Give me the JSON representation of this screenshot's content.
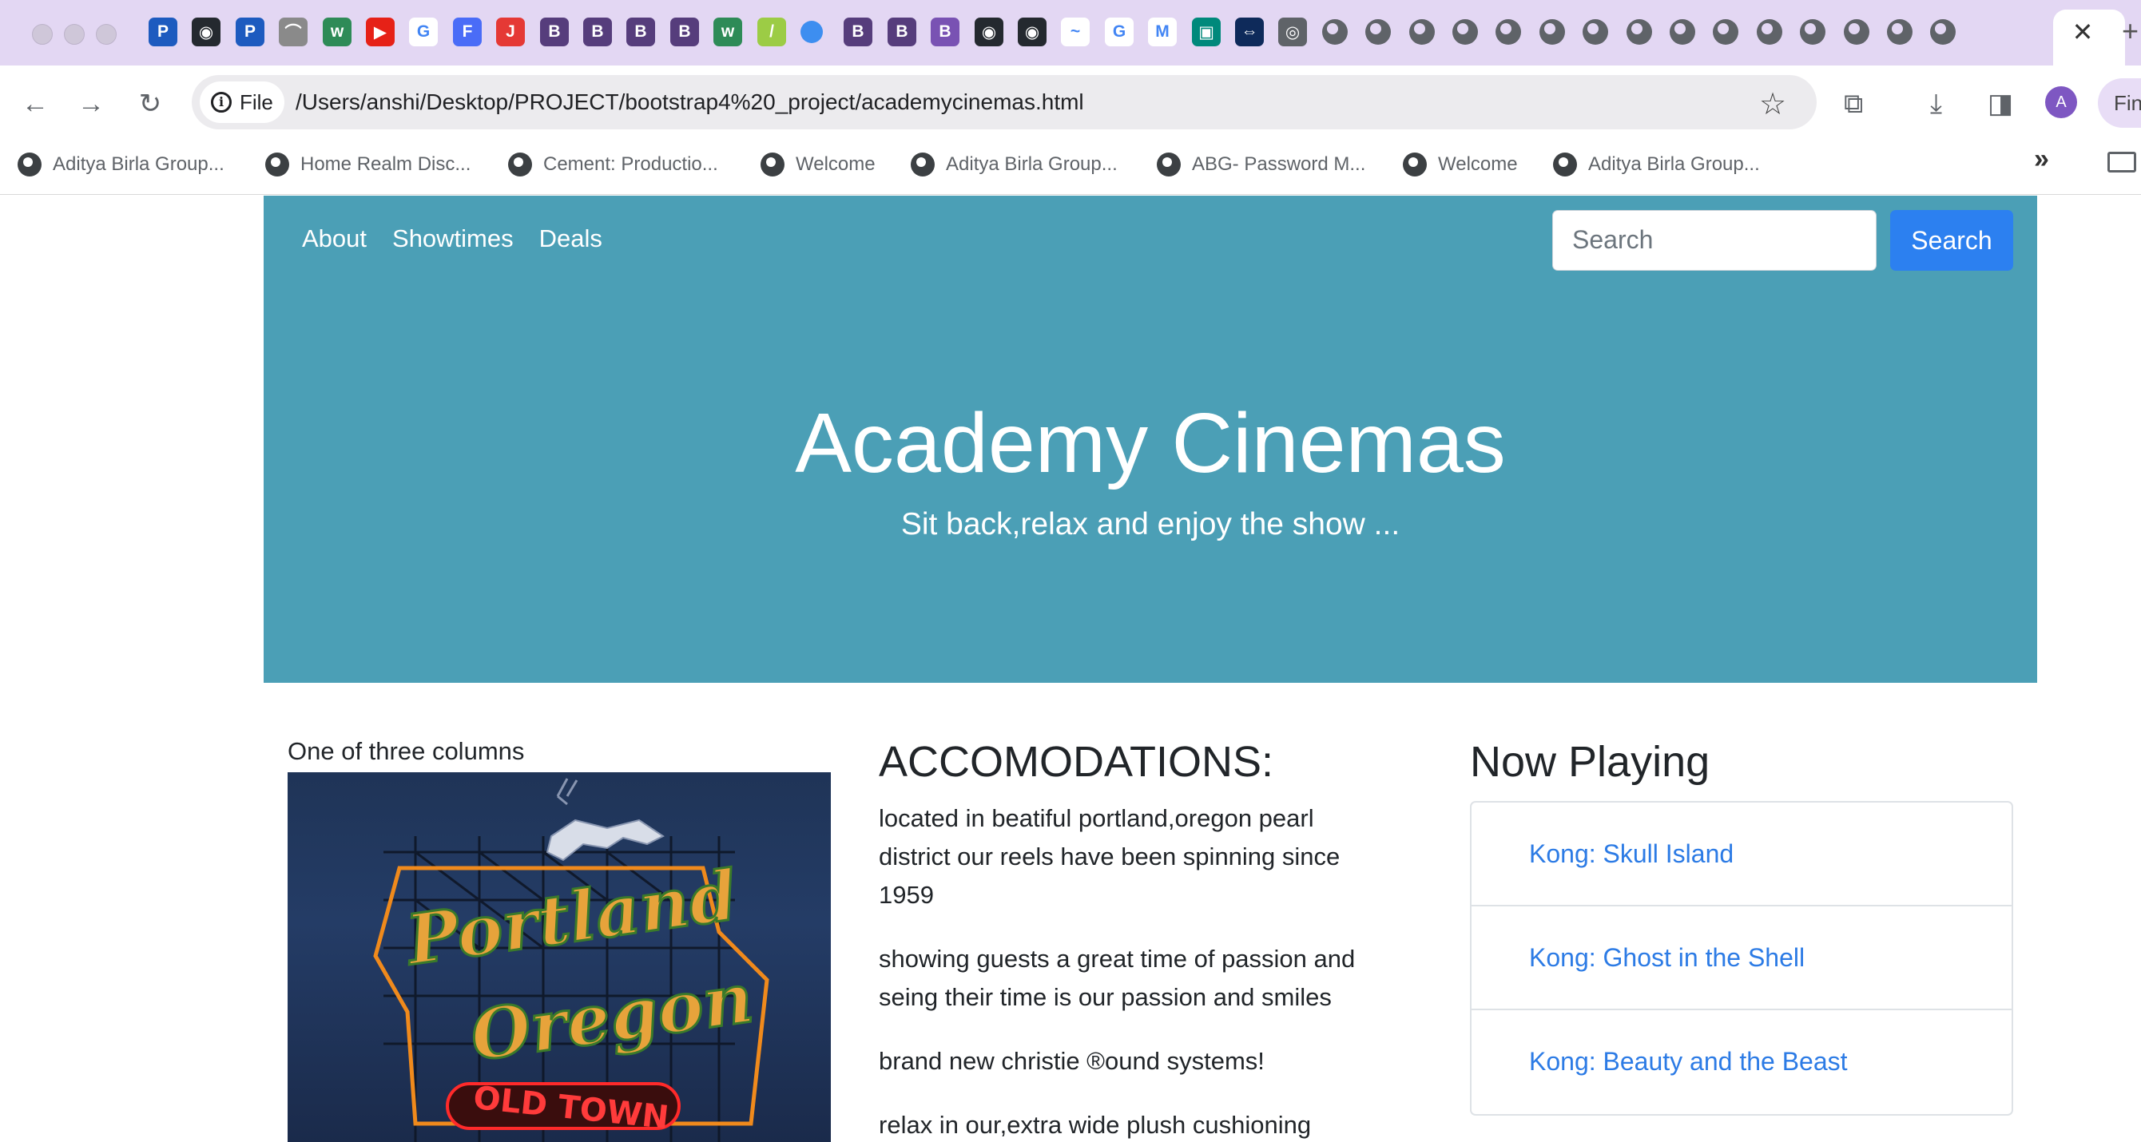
{
  "browser": {
    "tab_close_glyph": "✕",
    "new_tab_glyph": "+",
    "find_label": "Fin",
    "avatar_initial": "A",
    "tab_icons": [
      {
        "name": "pcloud-icon",
        "color": "#1d5bbf",
        "glyph": "P"
      },
      {
        "name": "github-icon",
        "color": "#24292f",
        "glyph": "◉"
      },
      {
        "name": "pcloud-icon",
        "color": "#1d5bbf",
        "glyph": "P"
      },
      {
        "name": "arc-icon",
        "color": "#8a8a8a",
        "glyph": "⌒"
      },
      {
        "name": "w3schools-icon",
        "color": "#2e8b57",
        "glyph": "w"
      },
      {
        "name": "youtube-icon",
        "color": "#e62117",
        "glyph": "▶"
      },
      {
        "name": "google-icon",
        "color": "#ffffff",
        "glyph": "G"
      },
      {
        "name": "forms-icon",
        "color": "#4a6cf7",
        "glyph": "F"
      },
      {
        "name": "app-icon",
        "color": "#e53935",
        "glyph": "J"
      },
      {
        "name": "bootstrap-icon",
        "color": "#563d7c",
        "glyph": "B"
      },
      {
        "name": "bootstrap-icon",
        "color": "#563d7c",
        "glyph": "B"
      },
      {
        "name": "bootstrap-icon",
        "color": "#563d7c",
        "glyph": "B"
      },
      {
        "name": "bootstrap-icon",
        "color": "#563d7c",
        "glyph": "B"
      },
      {
        "name": "w3schools-icon",
        "color": "#2e8b57",
        "glyph": "w"
      },
      {
        "name": "notes-icon",
        "color": "#9ccc45",
        "glyph": "/"
      },
      {
        "name": "dot-icon",
        "color": "#3d8ef0",
        "glyph": ""
      },
      {
        "name": "bootstrap-icon",
        "color": "#563d7c",
        "glyph": "B"
      },
      {
        "name": "bootstrap-icon",
        "color": "#563d7c",
        "glyph": "B"
      },
      {
        "name": "bootstrap-icon",
        "color": "#7952b3",
        "glyph": "B"
      },
      {
        "name": "github-icon",
        "color": "#24292f",
        "glyph": "◉"
      },
      {
        "name": "github-icon",
        "color": "#24292f",
        "glyph": "◉"
      },
      {
        "name": "chart-icon",
        "color": "#ffffff",
        "glyph": "~"
      },
      {
        "name": "google-icon",
        "color": "#ffffff",
        "glyph": "G"
      },
      {
        "name": "gmail-icon",
        "color": "#ffffff",
        "glyph": "M"
      },
      {
        "name": "meet-icon",
        "color": "#00897b",
        "glyph": "▣"
      },
      {
        "name": "teamviewer-icon",
        "color": "#0e2a5a",
        "glyph": "⇔"
      },
      {
        "name": "chrome-icon",
        "color": "#5f6368",
        "glyph": "◎"
      },
      {
        "name": "globe-icon",
        "color": "#5f6368",
        "glyph": ""
      },
      {
        "name": "globe-icon",
        "color": "#5f6368",
        "glyph": ""
      },
      {
        "name": "globe-icon",
        "color": "#5f6368",
        "glyph": ""
      },
      {
        "name": "globe-icon",
        "color": "#5f6368",
        "glyph": ""
      },
      {
        "name": "globe-icon",
        "color": "#5f6368",
        "glyph": ""
      },
      {
        "name": "globe-icon",
        "color": "#5f6368",
        "glyph": ""
      },
      {
        "name": "globe-icon",
        "color": "#5f6368",
        "glyph": ""
      },
      {
        "name": "globe-icon",
        "color": "#5f6368",
        "glyph": ""
      },
      {
        "name": "globe-icon",
        "color": "#5f6368",
        "glyph": ""
      },
      {
        "name": "globe-icon",
        "color": "#5f6368",
        "glyph": ""
      },
      {
        "name": "globe-icon",
        "color": "#5f6368",
        "glyph": ""
      },
      {
        "name": "globe-icon",
        "color": "#5f6368",
        "glyph": ""
      },
      {
        "name": "globe-icon",
        "color": "#5f6368",
        "glyph": ""
      },
      {
        "name": "globe-icon",
        "color": "#5f6368",
        "glyph": ""
      },
      {
        "name": "globe-icon",
        "color": "#5f6368",
        "glyph": ""
      }
    ]
  },
  "toolbar": {
    "file_label": "File",
    "url": "/Users/anshi/Desktop/PROJECT/bootstrap4%20_project/academycinemas.html"
  },
  "bookmarks": [
    "Aditya Birla Group...",
    "Home Realm Disc...",
    "Cement: Productio...",
    "Welcome",
    "Aditya Birla Group...",
    "ABG- Password M...",
    "Welcome",
    "Aditya Birla Group..."
  ],
  "page": {
    "nav": [
      "About",
      "Showtimes",
      "Deals"
    ],
    "search_placeholder": "Search",
    "search_button": "Search",
    "title": "Academy Cinemas",
    "subtitle": "Sit back,relax and enjoy the show ...",
    "col1_title": "One of three columns",
    "image_sign": {
      "line1": "Portland",
      "line2": "Oregon",
      "line3": "OLD TOWN"
    },
    "accommodations_title": "ACCOMODATIONS:",
    "accommodations_paragraphs": [
      "located in beatiful portland,oregon pearl district our reels have been spinning since 1959",
      "showing guests a great time of passion and seing their time is our passion and smiles",
      "brand new christie ®ound systems!",
      "relax in our,extra wide plush cushioning"
    ],
    "now_playing_title": "Now Playing",
    "now_playing": [
      "Kong: Skull Island",
      "Kong: Ghost in the Shell",
      "Kong: Beauty and the Beast"
    ],
    "colors": {
      "jumbotron": "#4b9fb6",
      "primary": "#2c80f0",
      "link": "#2c7be5",
      "tabstrip": "#e3d7f3"
    }
  }
}
